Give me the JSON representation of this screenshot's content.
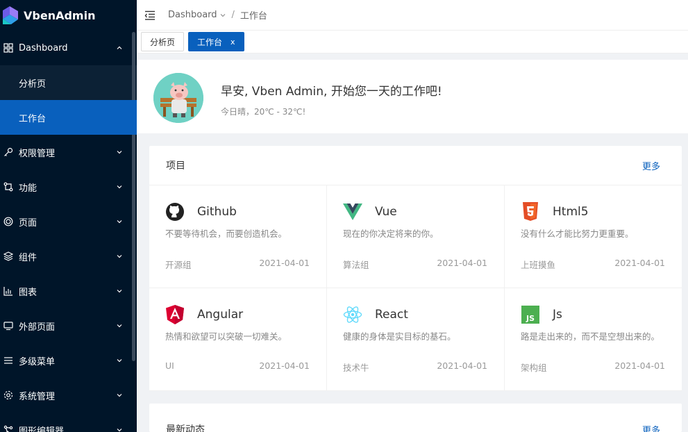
{
  "app": {
    "name": "VbenAdmin"
  },
  "sidebar": {
    "items": [
      {
        "label": "Dashboard",
        "icon": "dashboard-icon",
        "expanded": true,
        "children": [
          {
            "label": "分析页",
            "active": false
          },
          {
            "label": "工作台",
            "active": true
          }
        ]
      },
      {
        "label": "权限管理",
        "icon": "key-icon"
      },
      {
        "label": "功能",
        "icon": "function-icon"
      },
      {
        "label": "页面",
        "icon": "page-icon"
      },
      {
        "label": "组件",
        "icon": "components-icon"
      },
      {
        "label": "图表",
        "icon": "chart-icon"
      },
      {
        "label": "外部页面",
        "icon": "monitor-icon"
      },
      {
        "label": "多级菜单",
        "icon": "menu-icon"
      },
      {
        "label": "系统管理",
        "icon": "gear-icon"
      },
      {
        "label": "图形编辑器",
        "icon": "graph-icon"
      }
    ]
  },
  "header": {
    "breadcrumb": [
      "Dashboard",
      "工作台"
    ],
    "separator": "/"
  },
  "tabs": [
    {
      "label": "分析页",
      "active": false
    },
    {
      "label": "工作台",
      "active": true,
      "close": "x"
    }
  ],
  "greeting": {
    "title": "早安, Vben Admin, 开始您一天的工作吧!",
    "subtitle": "今日晴，20℃ - 32℃!"
  },
  "projects": {
    "title": "项目",
    "more": "更多",
    "items": [
      {
        "name": "Github",
        "icon": "github-icon",
        "color": "#222222",
        "desc": "不要等待机会，而要创造机会。",
        "group": "开源组",
        "date": "2021-04-01"
      },
      {
        "name": "Vue",
        "icon": "vue-icon",
        "color": "#42b883",
        "desc": "现在的你决定将来的你。",
        "group": "算法组",
        "date": "2021-04-01"
      },
      {
        "name": "Html5",
        "icon": "html5-icon",
        "color": "#e44d26",
        "desc": "没有什么才能比努力更重要。",
        "group": "上班摸鱼",
        "date": "2021-04-01"
      },
      {
        "name": "Angular",
        "icon": "angular-icon",
        "color": "#dd0031",
        "desc": "热情和欲望可以突破一切难关。",
        "group": "UI",
        "date": "2021-04-01"
      },
      {
        "name": "React",
        "icon": "react-icon",
        "color": "#61dafb",
        "desc": "健康的身体是实目标的基石。",
        "group": "技术牛",
        "date": "2021-04-01"
      },
      {
        "name": "Js",
        "icon": "js-icon",
        "color": "#4caf50",
        "desc": "路是走出来的，而不是空想出来的。",
        "group": "架构组",
        "date": "2021-04-01"
      }
    ]
  },
  "activity": {
    "title": "最新动态",
    "more": "更多"
  },
  "colors": {
    "primary": "#0960bd",
    "sidebar_bg": "#001529"
  }
}
